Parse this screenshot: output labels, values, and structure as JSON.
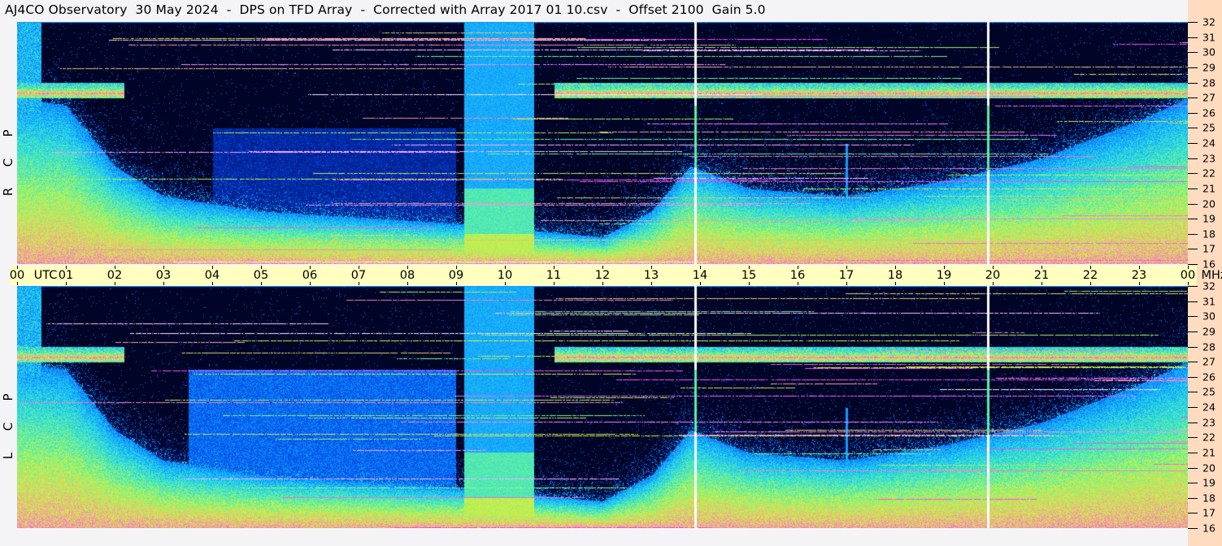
{
  "title": "AJ4CO Observatory  30 May 2024  -  DPS on TFD Array  -  Corrected with Array 2017 01 10.csv  -  Offset 2100  Gain 5.0",
  "chart_data": {
    "type": "heatmap",
    "title": "AJ4CO Observatory  30 May 2024  -  DPS on TFD Array  -  Corrected with Array 2017 01 10.csv  -  Offset 2100  Gain 5.0",
    "xlabel": "UTC",
    "ylabel": "MHz",
    "xlim": [
      0,
      24
    ],
    "ylim": [
      16,
      32
    ],
    "x_tick_labels": [
      "00",
      "01",
      "02",
      "03",
      "04",
      "05",
      "06",
      "07",
      "08",
      "09",
      "10",
      "11",
      "12",
      "13",
      "14",
      "15",
      "16",
      "17",
      "18",
      "19",
      "20",
      "21",
      "22",
      "23",
      "00"
    ],
    "y_tick_labels": [
      "32",
      "31",
      "30",
      "29",
      "28",
      "27",
      "26",
      "25",
      "24",
      "23",
      "22",
      "21",
      "20",
      "19",
      "18",
      "17",
      "16"
    ],
    "panels": [
      {
        "name": "RCP",
        "letters": [
          "R",
          "C",
          "P"
        ]
      },
      {
        "name": "LCP",
        "letters": [
          "L",
          "C",
          "P"
        ]
      }
    ],
    "features": {
      "broadband_stripe_utc": [
        9.15,
        10.6
      ],
      "vertical_markers_utc": [
        13.9,
        19.9,
        17.0
      ],
      "cb_band_mhz": [
        27.0,
        28.0
      ]
    },
    "colormap": [
      "#000010",
      "#001060",
      "#0040e0",
      "#1090ff",
      "#20d0f0",
      "#60f0a0",
      "#d0f040",
      "#f0a0a0",
      "#ff40ff",
      "#ffffff"
    ],
    "grid": false
  }
}
